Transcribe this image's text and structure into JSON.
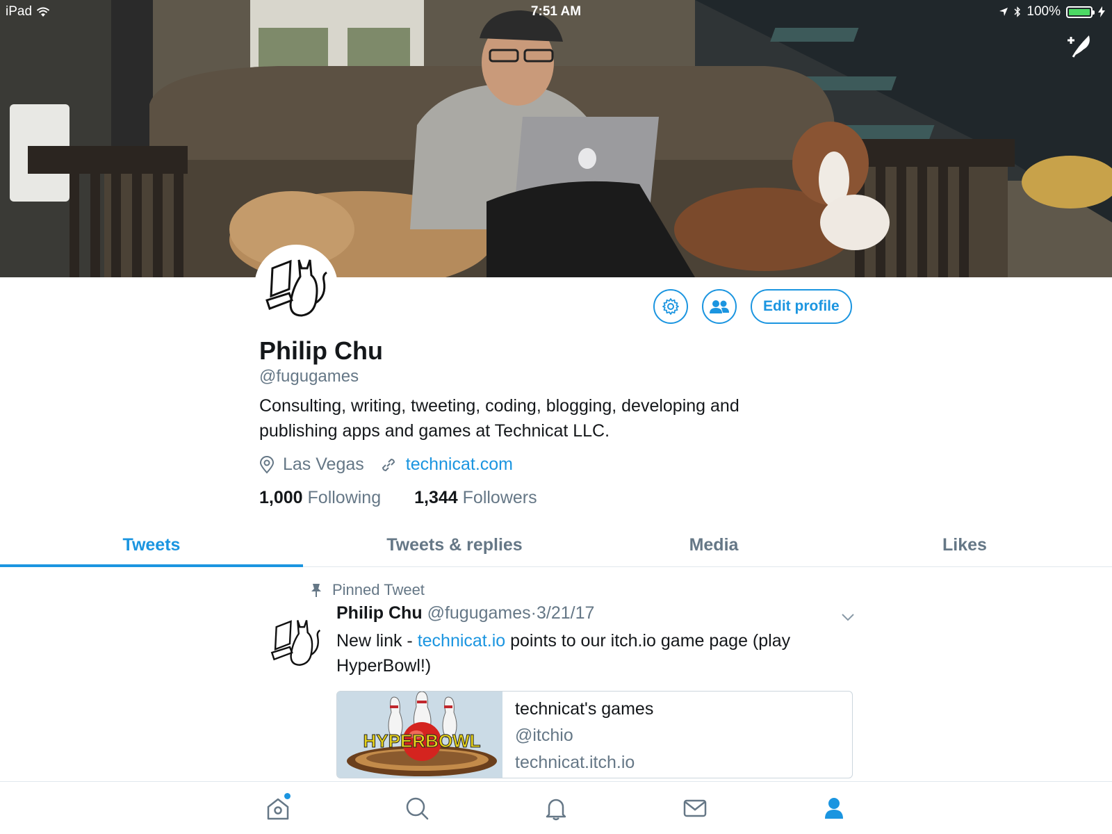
{
  "status_bar": {
    "device": "iPad",
    "time": "7:51 AM",
    "battery": "100%"
  },
  "profile": {
    "name": "Philip Chu",
    "handle": "@fugugames",
    "bio": "Consulting, writing, tweeting, coding, blogging, developing and publishing apps and games at Technicat LLC.",
    "location": "Las Vegas",
    "website": "technicat.com",
    "following_count": "1,000",
    "following_label": "Following",
    "followers_count": "1,344",
    "followers_label": "Followers",
    "edit_profile_label": "Edit profile"
  },
  "tabs": [
    {
      "label": "Tweets",
      "active": true
    },
    {
      "label": "Tweets & replies",
      "active": false
    },
    {
      "label": "Media",
      "active": false
    },
    {
      "label": "Likes",
      "active": false
    }
  ],
  "pinned_tweet": {
    "pinned_label": "Pinned Tweet",
    "author_name": "Philip Chu",
    "author_handle": "@fugugames",
    "separator": "·",
    "date": "3/21/17",
    "text_before": "New link - ",
    "text_link": "technicat.io",
    "text_after": " points to our itch.io game page (play HyperBowl!)",
    "card": {
      "title": "technicat's games",
      "site_handle": "@itchio",
      "domain": "technicat.itch.io",
      "image_text": "HYPERBOWL"
    }
  },
  "bottom_nav": [
    {
      "icon": "home-icon",
      "active": false,
      "notification_dot": true
    },
    {
      "icon": "search-icon",
      "active": false
    },
    {
      "icon": "bell-icon",
      "active": false
    },
    {
      "icon": "mail-icon",
      "active": false
    },
    {
      "icon": "person-icon",
      "active": true
    }
  ],
  "colors": {
    "accent": "#1b95e0",
    "text_primary": "#14171a",
    "text_secondary": "#657786",
    "border": "#e1e8ed",
    "battery": "#4cd964"
  }
}
